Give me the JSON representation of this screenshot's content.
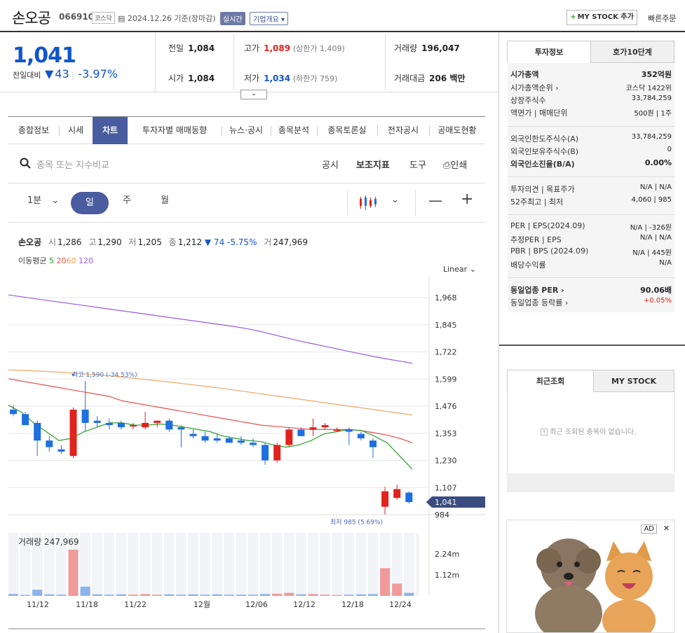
{
  "header": {
    "name": "손오공",
    "code": "066910",
    "market": "코스닥",
    "date": "2024.12.26 기준(장마감)",
    "live": "실시간",
    "company_info": "기업개요 ▾",
    "my_stock_add": "MY STOCK 추가",
    "quick_order": "빠른주문"
  },
  "price": {
    "current": "1,041",
    "change_label": "전일대비",
    "change": "43",
    "change_pct": "-3.97%",
    "prev_close_k": "전일",
    "prev_close": "1,084",
    "open_k": "시가",
    "open": "1,084",
    "high_k": "고가",
    "high": "1,089",
    "upper_limit": "(상한가 1,409)",
    "low_k": "저가",
    "low": "1,034",
    "lower_limit": "(하한가 759)",
    "volume_k": "거래량",
    "volume": "196,047",
    "amount_k": "거래대금",
    "amount": "206 백만"
  },
  "tabs": [
    "종합정보",
    "시세",
    "차트",
    "투자자별 매매동향",
    "뉴스·공시",
    "종목분석",
    "종목토론실",
    "전자공시",
    "공매도현황"
  ],
  "search": {
    "placeholder": "종목 또는 지수비교",
    "tools": [
      "공시",
      "보조지표",
      "도구",
      "인쇄"
    ]
  },
  "periods": [
    "1분",
    "일",
    "주",
    "월"
  ],
  "chart_info": {
    "name": "손오공",
    "o_k": "시",
    "o": "1,286",
    "h_k": "고",
    "h": "1,290",
    "l_k": "저",
    "l": "1,205",
    "c_k": "종",
    "c": "1,212",
    "chg": "▼ 74 -5.75%",
    "v_k": "거",
    "v": "247,969",
    "ma_label": "이동평균",
    "ma5": "5",
    "ma20": "20",
    "ma60": "60",
    "ma120": "120",
    "scale": "Linear",
    "max_label": "최고 1,590 (-34.53%)",
    "min_label": "최저 985 (5.69%)",
    "vol_label": "거래량 247,969",
    "last_price": "1,041"
  },
  "chart_data": {
    "type": "candlestick",
    "price_ticks": [
      1968,
      1845,
      1722,
      1599,
      1476,
      1353,
      1230,
      1107,
      984
    ],
    "price_tick_labels": [
      "1,968",
      "1,845",
      "1,722",
      "1,599",
      "1,476",
      "1,353",
      "1,230",
      "1,107",
      "984"
    ],
    "volume_ticks": [
      "2.24m",
      "1.12m"
    ],
    "date_labels": [
      "11/12",
      "11/18",
      "11/22",
      "12월",
      "12/06",
      "12/12",
      "12/18",
      "12/24"
    ],
    "candles": [
      {
        "o": 1460,
        "h": 1480,
        "l": 1430,
        "c": 1440
      },
      {
        "o": 1440,
        "h": 1450,
        "l": 1390,
        "c": 1390
      },
      {
        "o": 1400,
        "h": 1410,
        "l": 1250,
        "c": 1320
      },
      {
        "o": 1320,
        "h": 1340,
        "l": 1270,
        "c": 1290
      },
      {
        "o": 1280,
        "h": 1300,
        "l": 1260,
        "c": 1270
      },
      {
        "o": 1250,
        "h": 1470,
        "l": 1240,
        "c": 1460
      },
      {
        "o": 1460,
        "h": 1590,
        "l": 1360,
        "c": 1400
      },
      {
        "o": 1410,
        "h": 1430,
        "l": 1380,
        "c": 1400
      },
      {
        "o": 1400,
        "h": 1420,
        "l": 1370,
        "c": 1390
      },
      {
        "o": 1400,
        "h": 1410,
        "l": 1370,
        "c": 1380
      },
      {
        "o": 1390,
        "h": 1400,
        "l": 1370,
        "c": 1390
      },
      {
        "o": 1380,
        "h": 1450,
        "l": 1370,
        "c": 1400
      },
      {
        "o": 1400,
        "h": 1410,
        "l": 1380,
        "c": 1410
      },
      {
        "o": 1410,
        "h": 1420,
        "l": 1360,
        "c": 1370
      },
      {
        "o": 1380,
        "h": 1390,
        "l": 1290,
        "c": 1370
      },
      {
        "o": 1350,
        "h": 1370,
        "l": 1330,
        "c": 1340
      },
      {
        "o": 1340,
        "h": 1360,
        "l": 1310,
        "c": 1320
      },
      {
        "o": 1330,
        "h": 1350,
        "l": 1310,
        "c": 1320
      },
      {
        "o": 1330,
        "h": 1340,
        "l": 1310,
        "c": 1310
      },
      {
        "o": 1320,
        "h": 1340,
        "l": 1300,
        "c": 1310
      },
      {
        "o": 1310,
        "h": 1330,
        "l": 1290,
        "c": 1300
      },
      {
        "o": 1300,
        "h": 1310,
        "l": 1210,
        "c": 1230
      },
      {
        "o": 1230,
        "h": 1310,
        "l": 1220,
        "c": 1300
      },
      {
        "o": 1300,
        "h": 1380,
        "l": 1290,
        "c": 1370
      },
      {
        "o": 1370,
        "h": 1380,
        "l": 1340,
        "c": 1340
      },
      {
        "o": 1370,
        "h": 1420,
        "l": 1340,
        "c": 1380
      },
      {
        "o": 1380,
        "h": 1400,
        "l": 1370,
        "c": 1390
      },
      {
        "o": 1370,
        "h": 1380,
        "l": 1360,
        "c": 1370
      },
      {
        "o": 1370,
        "h": 1380,
        "l": 1300,
        "c": 1360
      },
      {
        "o": 1350,
        "h": 1360,
        "l": 1320,
        "c": 1330
      },
      {
        "o": 1320,
        "h": 1330,
        "l": 1240,
        "c": 1290
      },
      {
        "o": 1020,
        "h": 1110,
        "l": 985,
        "c": 1090
      },
      {
        "o": 1060,
        "h": 1120,
        "l": 1050,
        "c": 1100
      },
      {
        "o": 1084,
        "h": 1089,
        "l": 1034,
        "c": 1041
      }
    ],
    "volumes": [
      0.06,
      0.03,
      0.2,
      0.05,
      0.04,
      1.5,
      0.3,
      0.05,
      0.04,
      0.05,
      0.04,
      0.06,
      0.04,
      0.05,
      0.04,
      0.05,
      0.04,
      0.05,
      0.04,
      0.04,
      0.04,
      0.06,
      0.07,
      0.1,
      0.05,
      0.06,
      0.04,
      0.03,
      0.04,
      0.05,
      0.06,
      0.9,
      0.4,
      0.1
    ],
    "ma5": [
      1480,
      1450,
      1400,
      1360,
      1320,
      1330,
      1360,
      1380,
      1400,
      1400,
      1390,
      1390,
      1395,
      1390,
      1380,
      1370,
      1360,
      1340,
      1330,
      1320,
      1315,
      1300,
      1290,
      1300,
      1320,
      1350,
      1360,
      1370,
      1365,
      1340,
      1310,
      1250,
      1190
    ],
    "ma20": [
      1600,
      1590,
      1580,
      1570,
      1560,
      1550,
      1540,
      1530,
      1520,
      1500,
      1490,
      1480,
      1470,
      1460,
      1450,
      1440,
      1430,
      1420,
      1410,
      1400,
      1390,
      1385,
      1380,
      1375,
      1370,
      1370,
      1370,
      1370,
      1365,
      1355,
      1345,
      1330,
      1310
    ],
    "ma60": [
      1640,
      1638,
      1636,
      1633,
      1630,
      1626,
      1622,
      1618,
      1613,
      1608,
      1602,
      1596,
      1590,
      1584,
      1577,
      1570,
      1563,
      1556,
      1548,
      1540,
      1532,
      1524,
      1516,
      1508,
      1500,
      1492,
      1484,
      1476,
      1468,
      1460,
      1452,
      1444,
      1436
    ],
    "ma120": [
      1980,
      1972,
      1964,
      1956,
      1948,
      1940,
      1932,
      1924,
      1916,
      1908,
      1900,
      1892,
      1884,
      1876,
      1868,
      1860,
      1852,
      1844,
      1836,
      1826,
      1814,
      1800,
      1786,
      1772,
      1760,
      1748,
      1736,
      1724,
      1712,
      1700,
      1690,
      1680,
      1670
    ]
  },
  "invest": {
    "tab1": "투자정보",
    "tab2": "호가10단계",
    "rows": [
      {
        "k": "시가총액",
        "v": "352억원",
        "bold": true
      },
      {
        "k": "시가총액순위 ›",
        "v": "코스닥 1422위"
      },
      {
        "k": "상장주식수",
        "v": "33,784,259"
      },
      {
        "k": "액면가 | 매매단위",
        "v": "500원 | 1주"
      },
      {
        "k": "외국인한도주식수(A)",
        "v": "33,784,259"
      },
      {
        "k": "외국인보유주식수(B)",
        "v": "0"
      },
      {
        "k": "외국인소진율(B/A)",
        "v": "0.00%",
        "bold": true
      },
      {
        "k": "투자의견 | 목표주가",
        "v": "N/A | N/A"
      },
      {
        "k": "52주최고 | 최저",
        "v": "4,060 | 985"
      },
      {
        "k": "PER | EPS(2024.09)",
        "v": "N/A | -326원"
      },
      {
        "k": "추정PER | EPS",
        "v": "N/A | N/A"
      },
      {
        "k": "PBR | BPS (2024.09)",
        "v": "N/A | 445원"
      },
      {
        "k": "배당수익률",
        "v": "N/A"
      },
      {
        "k": "동일업종 PER ›",
        "v": "90.06배",
        "bold": true
      },
      {
        "k": "동일업종 등락률 ›",
        "v": "+0.05%",
        "red": true
      }
    ]
  },
  "recent": {
    "tab1": "최근조회",
    "tab2": "MY STOCK",
    "empty": "최근 조회된 종목이 없습니다."
  },
  "ad": {
    "label": "AD",
    "close": "✕"
  }
}
